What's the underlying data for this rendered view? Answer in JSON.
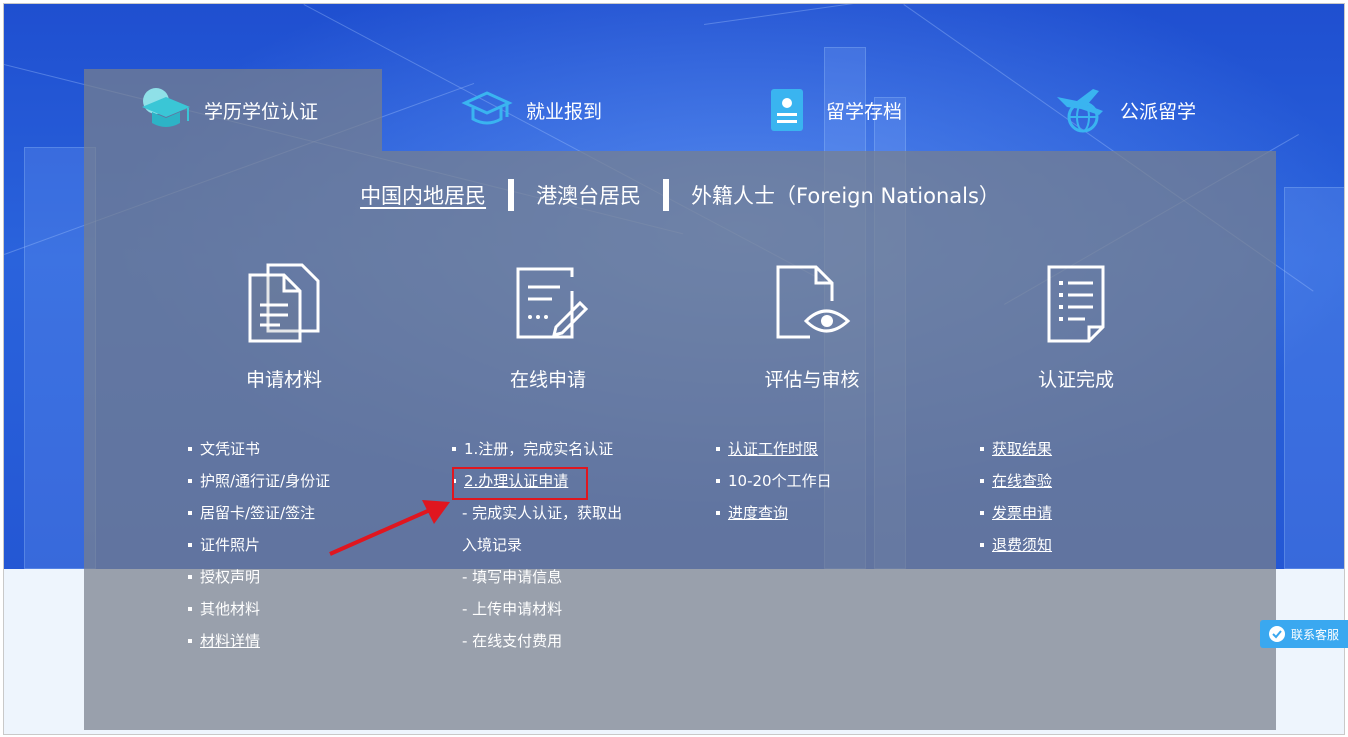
{
  "tabs": [
    {
      "label": "学历学位认证",
      "icon": "graduation-cap-icon",
      "active": true
    },
    {
      "label": "就业报到",
      "icon": "cap-badge-icon",
      "active": false
    },
    {
      "label": "留学存档",
      "icon": "archive-document-icon",
      "active": false
    },
    {
      "label": "公派留学",
      "icon": "plane-globe-icon",
      "active": false
    }
  ],
  "residency": {
    "mainland": "中国内地居民",
    "hk_mo_tw": "港澳台居民",
    "foreign": "外籍人士（Foreign Nationals）"
  },
  "steps": [
    {
      "title": "申请材料",
      "icon": "documents-icon"
    },
    {
      "title": "在线申请",
      "icon": "edit-form-icon"
    },
    {
      "title": "评估与审核",
      "icon": "document-eye-icon"
    },
    {
      "title": "认证完成",
      "icon": "checklist-icon"
    }
  ],
  "materials": [
    "文凭证书",
    "护照/通行证/身份证",
    "居留卡/签证/签注",
    "证件照片",
    "授权声明",
    "其他材料",
    "材料详情"
  ],
  "online": {
    "item1": "1.注册，完成实名认证",
    "item2": "2.办理认证申请",
    "sub1a": "- 完成实人认证，获取出",
    "sub1b": "入境记录",
    "sub2": "- 填写申请信息",
    "sub3": "- 上传申请材料",
    "sub4": "- 在线支付费用"
  },
  "review": [
    "认证工作时限",
    "10-20个工作日",
    "进度查询"
  ],
  "complete": [
    "获取结果",
    "在线查验",
    "发票申请",
    "退费须知"
  ],
  "customer_service": "联系客服",
  "colors": {
    "accent_blue": "#2457d4",
    "highlight_red": "#e0161f",
    "arrow_red": "#e0161f",
    "service_blue": "#3aa8f0"
  }
}
